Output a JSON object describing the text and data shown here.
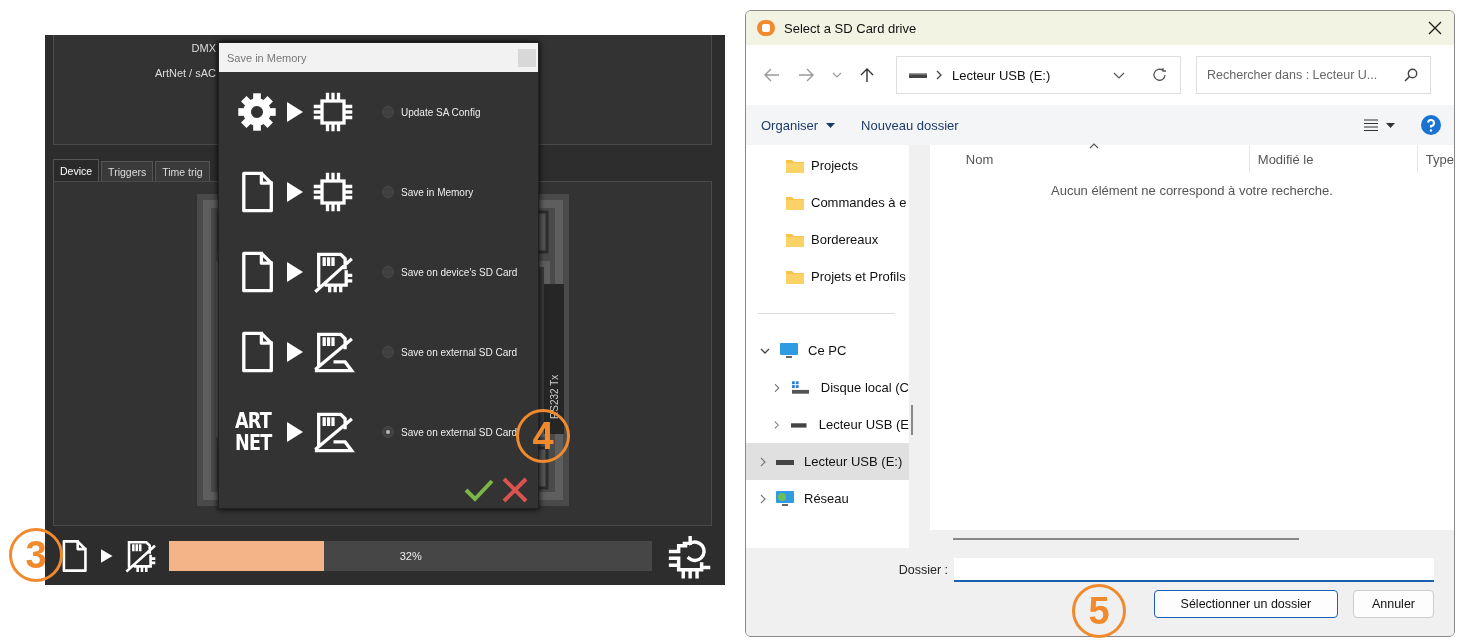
{
  "app": {
    "settings_labels": [
      "DMX",
      "ArtNet / sAC"
    ],
    "tabs": [
      {
        "label": "Device",
        "selected": true
      },
      {
        "label": "Triggers",
        "selected": false
      },
      {
        "label": "Time trig",
        "selected": false
      }
    ],
    "device": {
      "port_label": "RS232 Tx"
    },
    "save_dialog": {
      "title": "Save in Memory",
      "options": [
        {
          "source": {
            "kind": "gear"
          },
          "target": {
            "kind": "chip"
          },
          "label": "Update SA Config",
          "selected": false
        },
        {
          "source": {
            "kind": "file"
          },
          "target": {
            "kind": "chip"
          },
          "label": "Save in Memory",
          "selected": false
        },
        {
          "source": {
            "kind": "file"
          },
          "target": {
            "kind": "sd_device"
          },
          "label": "Save on device's SD Card",
          "selected": false
        },
        {
          "source": {
            "kind": "file"
          },
          "target": {
            "kind": "sd_external"
          },
          "label": "Save on external SD Card",
          "selected": false
        },
        {
          "source": {
            "kind": "text",
            "lines": [
              "ART",
              "NET"
            ]
          },
          "target": {
            "kind": "sd_external"
          },
          "label": "Save on external SD Card",
          "selected": true
        }
      ]
    },
    "transfer": {
      "source": {
        "kind": "file"
      },
      "target": {
        "kind": "sd_device"
      },
      "level": 0.32,
      "reading": "32%"
    }
  },
  "file_dialog": {
    "title": "Select a SD Card drive",
    "address": "Lecteur USB (E:)",
    "search_placeholder": "Rechercher dans : Lecteur U...",
    "toolbar": {
      "organize": "Organiser",
      "new_folder": "Nouveau dossier"
    },
    "quick_access": [
      {
        "label": "Projects"
      },
      {
        "label": "Commandes à e"
      },
      {
        "label": "Bordereaux"
      },
      {
        "label": "Projets et Profils"
      }
    ],
    "tree": [
      {
        "label": "Ce PC",
        "kind": "pc",
        "expanded": true,
        "selected": false,
        "children": [
          {
            "label": "Disque local (C",
            "kind": "disk",
            "expanded": false,
            "selected": false
          },
          {
            "label": "Lecteur USB (E",
            "kind": "usb",
            "expanded": false,
            "selected": false
          }
        ]
      },
      {
        "label": "Lecteur USB (E:)",
        "kind": "usb",
        "expanded": false,
        "selected": true
      },
      {
        "label": "Réseau",
        "kind": "network",
        "expanded": false,
        "selected": false
      }
    ],
    "columns": [
      {
        "label": "Nom",
        "sorted": true
      },
      {
        "label": "Modifié le",
        "sorted": false
      },
      {
        "label": "Type",
        "sorted": false
      }
    ],
    "empty_message": "Aucun élément ne correspond à votre recherche.",
    "folder_label": "Dossier :",
    "buttons": [
      {
        "label": "Sélectionner un dossier",
        "primary": true
      },
      {
        "label": "Annuler",
        "primary": false
      }
    ]
  },
  "callouts": [
    {
      "label": "3"
    },
    {
      "label": "4"
    },
    {
      "label": "5"
    }
  ]
}
